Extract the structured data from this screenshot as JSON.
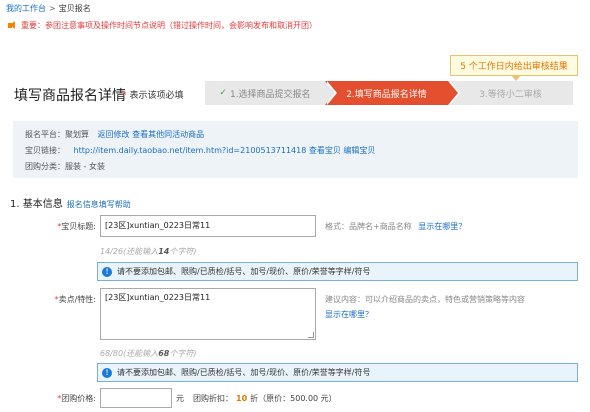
{
  "breadcrumb": {
    "home": "我的工作台",
    "sep": ">",
    "current": "宝贝报名"
  },
  "notice": "重要：参团注意事项及操作时间节点说明（错过操作时间，会影响发布和取消开团）",
  "review_tip": "5 个工作日内给出审核结果",
  "page_title": "填写商品报名详情",
  "required_note": "表示该项必填",
  "steps": [
    {
      "label": "1.选择商品提交报名",
      "state": "done"
    },
    {
      "label": "2.填写商品报名详情",
      "state": "active"
    },
    {
      "label": "3.等待小二审核",
      "state": "pending"
    }
  ],
  "info": {
    "platform_label": "报名平台：聚划算",
    "back_edit": "返回修改",
    "view_other": "查看其他同活动商品",
    "item_link_label": "宝贝链接：",
    "item_link": "http://item.daily.taobao.net/item.htm?id=2100513711418",
    "view_item": "查看宝贝",
    "edit_item": "编辑宝贝",
    "category": "团购分类：服装 - 女装"
  },
  "section": {
    "title": "1. 基本信息",
    "help": "报名信息填写帮助"
  },
  "form": {
    "title_label": "宝贝标题:",
    "title_value": "[23区]xuntian_0223日常11",
    "title_format": "格式：品牌名+商品名称",
    "where_shown": "显示在哪里？",
    "title_count_pre": "14/26(还能输入",
    "title_count_num": "14",
    "title_count_post": "个字符)",
    "title_warn": "请不要添加包邮、限购/已质检/括号、加号/现价、原价/荣誉等字样/符号",
    "selling_label": "卖点/特性:",
    "selling_value": "[23区]xuntian_0223日常11",
    "selling_suggest": "建议内容：可以介绍商品的卖点，特色或营销策略等内容",
    "selling_where": "显示在哪里？",
    "selling_count_pre": "68/80(还能输入",
    "selling_count_num": "68",
    "selling_count_post": "个字符)",
    "selling_warn": "请不要添加包邮、限购/已质检/括号、加号/现价、原价/荣誉等字样/符号",
    "price_label": "团购价格:",
    "price_unit": "元",
    "discount_label": "团购折扣：",
    "discount_value": "10",
    "discount_unit": "折（原价：500.00 元）"
  }
}
